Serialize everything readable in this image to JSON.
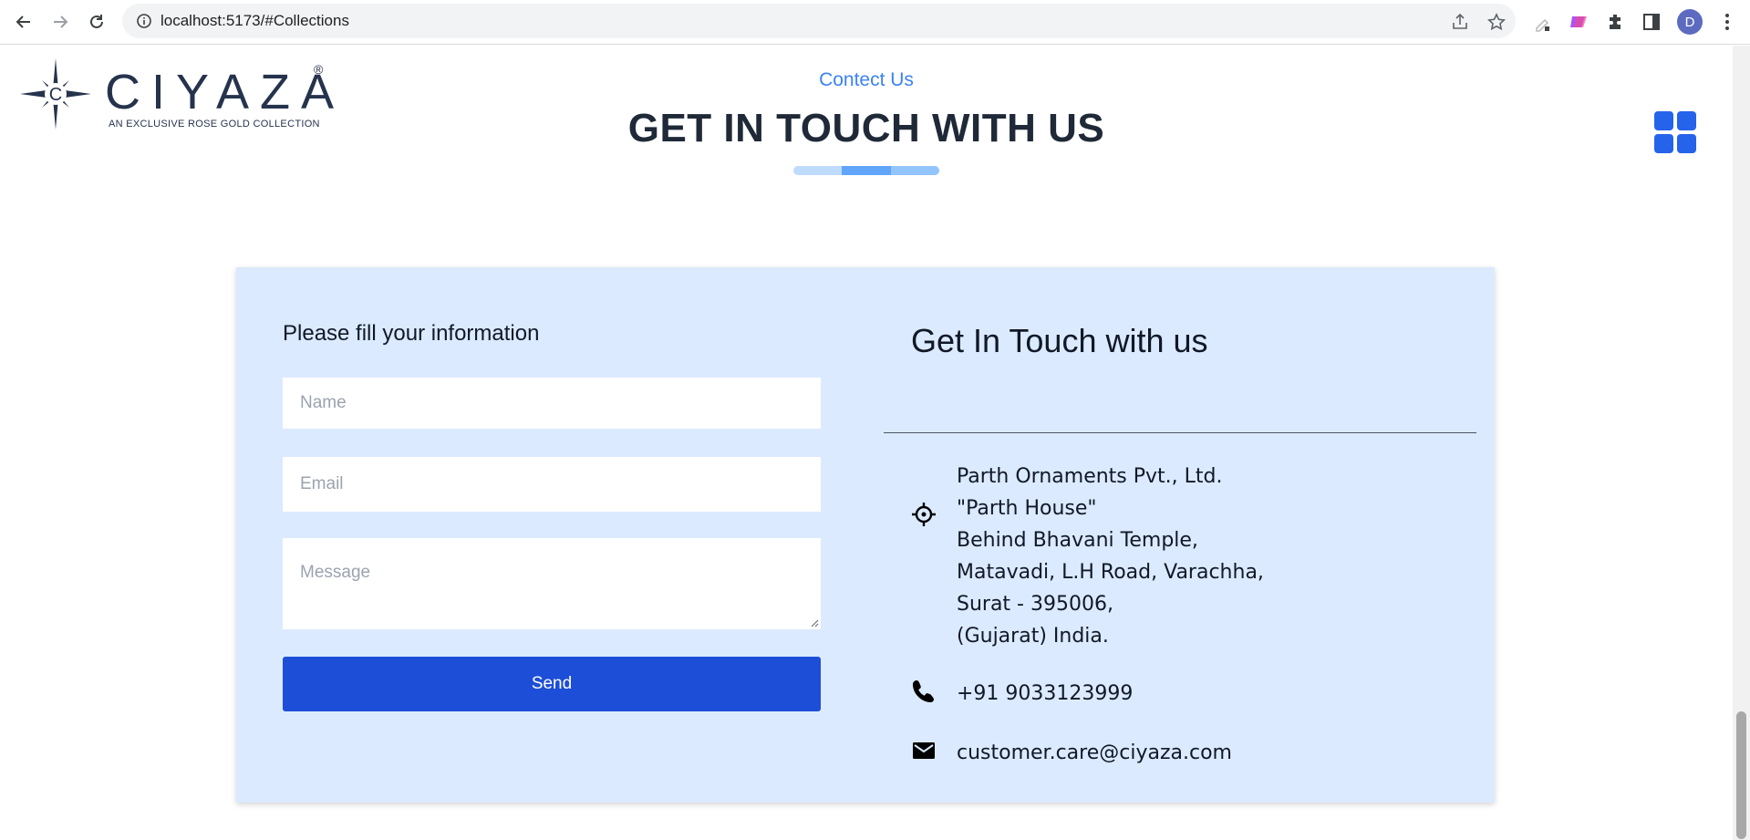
{
  "browser": {
    "url": "localhost:5173/#Collections",
    "profile_initial": "D"
  },
  "logo": {
    "wordmark": "CIYAZA",
    "registered": "®",
    "tagline": "AN EXCLUSIVE ROSE GOLD COLLECTION",
    "emblem_letter": "C"
  },
  "section": {
    "subtitle": "Contect Us",
    "title": "GET IN TOUCH WITH US"
  },
  "form": {
    "heading": "Please fill your information",
    "name_placeholder": "Name",
    "email_placeholder": "Email",
    "message_placeholder": "Message",
    "send_label": "Send"
  },
  "contact": {
    "heading": "Get In Touch with us",
    "address_lines": [
      "Parth Ornaments Pvt., Ltd.",
      "\"Parth House\"",
      "Behind Bhavani Temple,",
      "Matavadi, L.H Road, Varachha,",
      "Surat - 395006,",
      "(Gujarat) India."
    ],
    "phone": "+91 9033123999",
    "email": "customer.care@ciyaza.com"
  },
  "colors": {
    "accent": "#3b82f6",
    "button": "#1d4ed8",
    "card_bg": "#dbeafe",
    "grid_icon": "#2563eb"
  },
  "icons": {
    "address": "location-crosshair-icon",
    "phone": "phone-icon",
    "email": "mail-icon",
    "menu": "grid-menu-icon"
  }
}
